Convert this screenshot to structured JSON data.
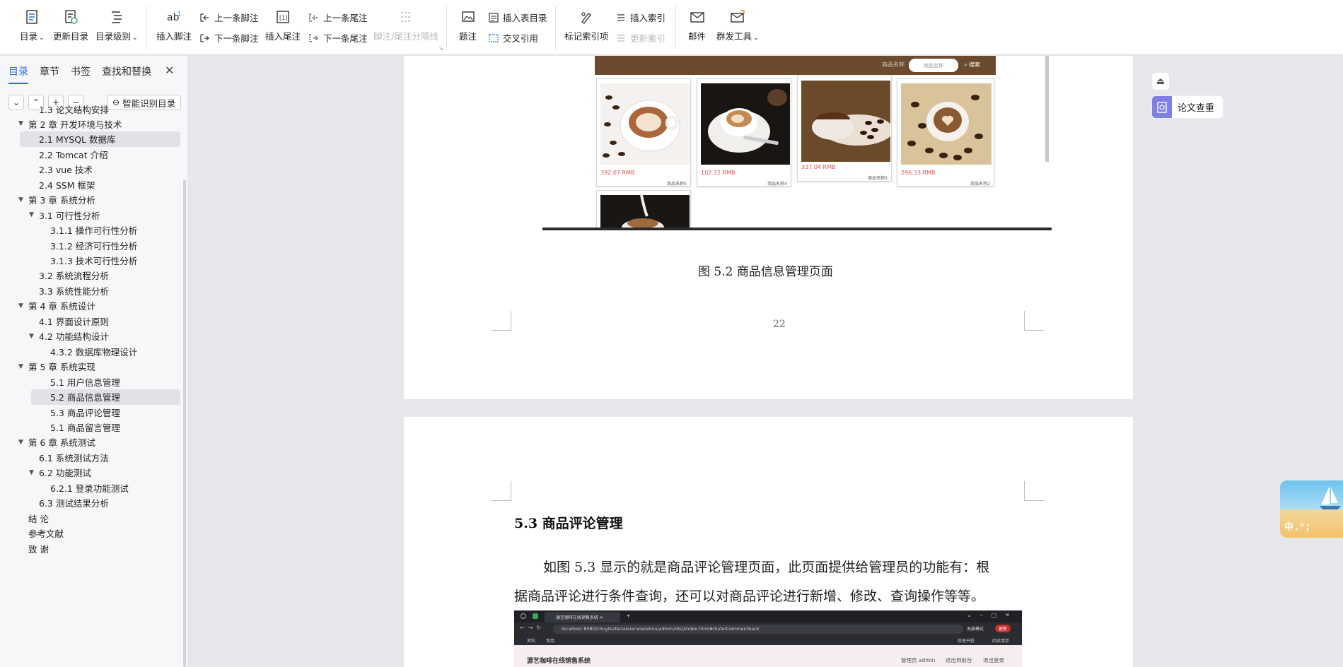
{
  "ribbon": {
    "toc": "目录",
    "update_toc": "更新目录",
    "toc_level": "目录级别",
    "insert_footnote": "插入脚注",
    "prev_footnote": "上一条脚注",
    "next_footnote": "下一条脚注",
    "insert_endnote": "插入尾注",
    "prev_endnote": "上一条尾注",
    "next_endnote": "下一条尾注",
    "separator": "脚注/尾注分隔线",
    "caption": "题注",
    "insert_table_of_figures": "插入表目录",
    "cross_reference": "交叉引用",
    "mark_index": "标记索引项",
    "insert_index": "插入索引",
    "update_index": "更新索引",
    "mail": "邮件",
    "mail_merge": "群发工具"
  },
  "nav": {
    "tabs": [
      "目录",
      "章节",
      "书签",
      "查找和替换"
    ],
    "smart_toc": "智能识别目录",
    "items": [
      {
        "label": "1.3 论文结构安排",
        "level": 1,
        "arrow": false,
        "selected": false
      },
      {
        "label": "第 2 章  开发环境与技术",
        "level": 0,
        "arrow": true,
        "selected": false
      },
      {
        "label": "2.1 MYSQL 数据库",
        "level": 1,
        "arrow": false,
        "selected": true
      },
      {
        "label": "2.2 Tomcat  介绍",
        "level": 1,
        "arrow": false,
        "selected": false
      },
      {
        "label": "2.3 vue 技术",
        "level": 1,
        "arrow": false,
        "selected": false
      },
      {
        "label": "2.4 SSM 框架",
        "level": 1,
        "arrow": false,
        "selected": false
      },
      {
        "label": "第 3 章  系统分析",
        "level": 0,
        "arrow": true,
        "selected": false
      },
      {
        "label": "3.1 可行性分析",
        "level": 1,
        "arrow": true,
        "selected": false
      },
      {
        "label": "3.1.1 操作可行性分析",
        "level": 2,
        "arrow": false,
        "selected": false
      },
      {
        "label": "3.1.2 经济可行性分析",
        "level": 2,
        "arrow": false,
        "selected": false
      },
      {
        "label": "3.1.3 技术可行性分析",
        "level": 2,
        "arrow": false,
        "selected": false
      },
      {
        "label": "3.2 系统流程分析",
        "level": 1,
        "arrow": false,
        "selected": false
      },
      {
        "label": "3.3 系统性能分析",
        "level": 1,
        "arrow": false,
        "selected": false
      },
      {
        "label": "第 4 章  系统设计",
        "level": 0,
        "arrow": true,
        "selected": false
      },
      {
        "label": "4.1 界面设计原则",
        "level": 1,
        "arrow": false,
        "selected": false
      },
      {
        "label": "4.2 功能结构设计",
        "level": 1,
        "arrow": true,
        "selected": false
      },
      {
        "label": "4.3.2  数据库物理设计",
        "level": 2,
        "arrow": false,
        "selected": false
      },
      {
        "label": "第 5 章  系统实现",
        "level": 0,
        "arrow": true,
        "selected": false
      },
      {
        "label": "5.1 用户信息管理",
        "level": 2,
        "arrow": false,
        "selected": false
      },
      {
        "label": "5.2  商品信息管理",
        "level": 2,
        "arrow": false,
        "selected": true
      },
      {
        "label": "5.3 商品评论管理",
        "level": 2,
        "arrow": false,
        "selected": false
      },
      {
        "label": "5.1 商品留言管理",
        "level": 2,
        "arrow": false,
        "selected": false
      },
      {
        "label": "第 6 章  系统测试",
        "level": 0,
        "arrow": true,
        "selected": false
      },
      {
        "label": "6.1  系统测试方法",
        "level": 1,
        "arrow": false,
        "selected": false
      },
      {
        "label": "6.2  功能测试",
        "level": 1,
        "arrow": true,
        "selected": false
      },
      {
        "label": "6.2.1  登录功能测试",
        "level": 2,
        "arrow": false,
        "selected": false
      },
      {
        "label": "6.3  测试结果分析",
        "level": 1,
        "arrow": false,
        "selected": false
      },
      {
        "label": "结    论",
        "level": 0,
        "arrow": false,
        "selected": false
      },
      {
        "label": "参考文献",
        "level": 0,
        "arrow": false,
        "selected": false
      },
      {
        "label": "致    谢",
        "level": 0,
        "arrow": false,
        "selected": false
      }
    ]
  },
  "figure": {
    "search_label": "商品名称",
    "search_placeholder": "商品名称",
    "search_button": "搜索",
    "products": [
      {
        "price": "392.07 RMB",
        "name": "商品名称5"
      },
      {
        "price": "102.72 RMB",
        "name": "商品名称4"
      },
      {
        "price": "337.04 RMB",
        "name": "商品名称3"
      },
      {
        "price": "296.33 RMB",
        "name": "商品名称2"
      }
    ]
  },
  "document": {
    "caption": "图 5.2  商品信息管理页面",
    "page_number": "22",
    "heading": "5.3 商品评论管理",
    "para_line1": "如图 5.3 显示的就是商品评论管理页面，此页面提供给管理员的功能有：根",
    "para_line2": "据商品评论进行条件查询，还可以对商品评论进行新增、修改、查询操作等等。"
  },
  "screenshot": {
    "tab_title": "源艺咖啡在线销售系统",
    "url": "localhost:8080/chuyikafeizaixianxiaoshou/admin/dist/index.html#/kafeiCommentback",
    "bookmark1": "资料",
    "bookmark2": "常用",
    "bookmark_other": "其他书签",
    "reading_list": "阅读清单",
    "incognito": "无痕模式",
    "update": "更新",
    "app_title": "源艺咖啡在线销售系统",
    "admin": "管理员 admin",
    "back_to_front": "退出到前台",
    "logout": "退出登录"
  },
  "right": {
    "thesis_check": "论文查重",
    "ime_text": "中.°;"
  }
}
